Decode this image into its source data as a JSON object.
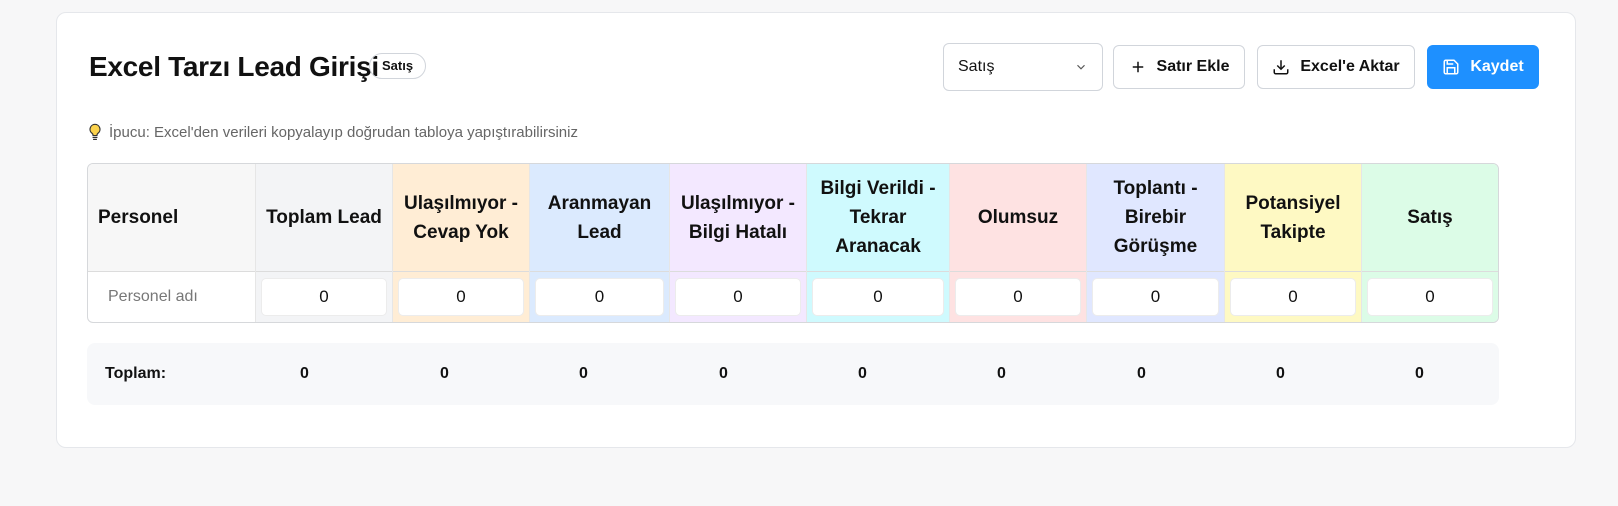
{
  "header": {
    "title": "Excel Tarzı Lead Girişi",
    "badge": "Satış",
    "select_value": "Satış",
    "add_row_label": "Satır Ekle",
    "export_label": "Excel'e Aktar",
    "save_label": "Kaydet"
  },
  "hint": "İpucu: Excel'den verileri kopyalayıp doğrudan tabloya yapıştırabilirsiniz",
  "table": {
    "columns": [
      {
        "label": "Personel",
        "color": "#f7f7f7"
      },
      {
        "label": "Toplam Lead",
        "color": "#f3f4f6"
      },
      {
        "label": "Ulaşılmıyor - Cevap Yok",
        "color": "#ffedd5"
      },
      {
        "label": "Aranmayan Lead",
        "color": "#dbeafe"
      },
      {
        "label": "Ulaşılmıyor - Bilgi Hatalı",
        "color": "#f3e8ff"
      },
      {
        "label": "Bilgi Verildi - Tekrar Aranacak",
        "color": "#cffafe"
      },
      {
        "label": "Olumsuz",
        "color": "#fee2e2"
      },
      {
        "label": "Toplantı - Birebir Görüşme",
        "color": "#e0e7ff"
      },
      {
        "label": "Potansiyel Takipte",
        "color": "#fef9c3"
      },
      {
        "label": "Satış",
        "color": "#dcfce7"
      }
    ],
    "row": {
      "name_placeholder": "Personel adı",
      "values": [
        "0",
        "0",
        "0",
        "0",
        "0",
        "0",
        "0",
        "0",
        "0"
      ]
    }
  },
  "totals": {
    "label": "Toplam:",
    "values": [
      "0",
      "0",
      "0",
      "0",
      "0",
      "0",
      "0",
      "0",
      "0"
    ]
  },
  "colors": {
    "accent": "#1e90ff"
  }
}
